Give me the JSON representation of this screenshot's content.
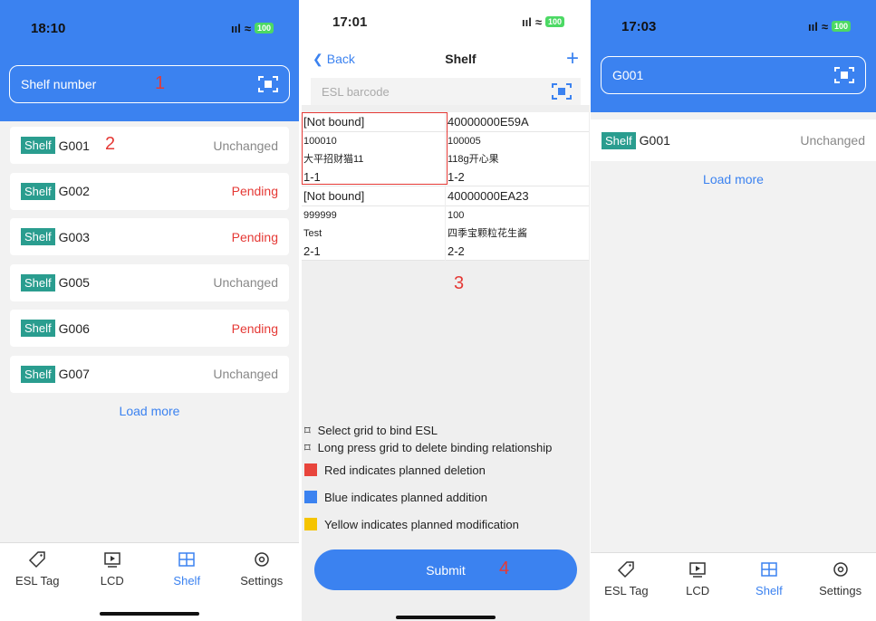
{
  "screen1": {
    "time": "18:10",
    "battery": "100",
    "search_placeholder": "Shelf number",
    "annotation": "1",
    "row_annotation": "2",
    "tag_label": "Shelf",
    "rows": [
      {
        "id": "G001",
        "status": "Unchanged"
      },
      {
        "id": "G002",
        "status": "Pending"
      },
      {
        "id": "G003",
        "status": "Pending"
      },
      {
        "id": "G005",
        "status": "Unchanged"
      },
      {
        "id": "G006",
        "status": "Pending"
      },
      {
        "id": "G007",
        "status": "Unchanged"
      }
    ],
    "load_more": "Load more"
  },
  "screen2": {
    "time": "17:01",
    "battery": "100",
    "back": "Back",
    "title": "Shelf",
    "plus": "+",
    "esl_placeholder": "ESL barcode",
    "grid": [
      {
        "header": "[Not bound]",
        "code": "100010",
        "name": "大平招财猫11",
        "pos": "1-1"
      },
      {
        "header": "40000000E59A",
        "code": "100005",
        "name": "118g开心果",
        "pos": "1-2"
      },
      {
        "header": "[Not bound]",
        "code": "999999",
        "name": "Test",
        "pos": "2-1"
      },
      {
        "header": "40000000EA23",
        "code": "100",
        "name": "四季宝颗粒花生酱",
        "pos": "2-2"
      }
    ],
    "annotation": "3",
    "hints": [
      "Select grid to bind ESL",
      "Long press grid to delete binding relationship"
    ],
    "legend": [
      "Red indicates planned deletion",
      "Blue indicates planned addition",
      "Yellow indicates planned modification"
    ],
    "legend_colors": [
      "#e8453c",
      "#3b82f0",
      "#f5c400"
    ],
    "submit": "Submit",
    "submit_annotation": "4"
  },
  "screen3": {
    "time": "17:03",
    "battery": "100",
    "search_value": "G001",
    "row": {
      "id": "G001",
      "status": "Unchanged"
    },
    "load_more": "Load more"
  },
  "tabs": [
    "ESL Tag",
    "LCD",
    "Shelf",
    "Settings"
  ],
  "colors": {
    "accent": "#3b82f0",
    "pending": "#e53935",
    "tag": "#2a9d8f"
  }
}
